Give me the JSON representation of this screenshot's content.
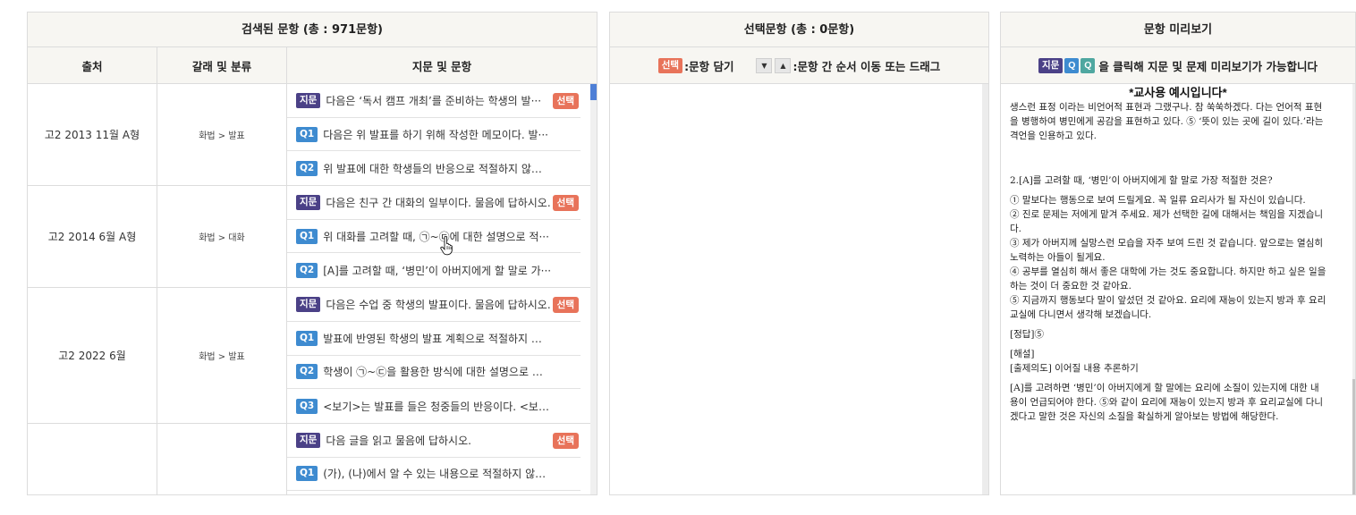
{
  "search_panel": {
    "title": "검색된 문항 (총 : 971문항)",
    "columns": [
      "출처",
      "갈래 및 분류",
      "지문 및 문항"
    ],
    "select_label": "선택",
    "groups": [
      {
        "source": "고2 2013 11월 A형",
        "category": "화법 > 발표",
        "items": [
          {
            "tag": "지문",
            "type": "passage",
            "text": "다음은 ‘독서 캠프 개최’를 준비하는 학생의 발···",
            "selectable": true
          },
          {
            "tag": "Q1",
            "type": "q",
            "text": "다음은 위 발표를 하기 위해 작성한 메모이다. 발···",
            "selectable": false
          },
          {
            "tag": "Q2",
            "type": "q",
            "text": "위 발표에 대한 학생들의 반응으로 적절하지 않은···",
            "selectable": false
          }
        ]
      },
      {
        "source": "고2 2014 6월 A형",
        "category": "화법 > 대화",
        "items": [
          {
            "tag": "지문",
            "type": "passage",
            "text": "다음은 친구 간 대화의 일부이다. 물음에 답하시오.",
            "selectable": true
          },
          {
            "tag": "Q1",
            "type": "q",
            "text": "위 대화를 고려할 때, ㉠~㉢에 대한 설명으로 적···",
            "selectable": false
          },
          {
            "tag": "Q2",
            "type": "q",
            "text": "[A]를 고려할 때, ‘병민’이 아버지에게 할 말로 가···",
            "selectable": false
          }
        ]
      },
      {
        "source": "고2 2022 6월",
        "category": "화법 > 발표",
        "items": [
          {
            "tag": "지문",
            "type": "passage",
            "text": "다음은 수업 중 학생의 발표이다. 물음에 답하시오.",
            "selectable": true
          },
          {
            "tag": "Q1",
            "type": "q",
            "text": "발표에 반영된 학생의 발표 계획으로 적절하지 않···",
            "selectable": false
          },
          {
            "tag": "Q2",
            "type": "q",
            "text": "학생이 ㉠~㉢을 활용한 방식에 대한 설명으로 가···",
            "selectable": false
          },
          {
            "tag": "Q3",
            "type": "q",
            "text": "<보기>는 발표를 들은 청중들의 반응이다. <보기···",
            "selectable": false
          }
        ]
      },
      {
        "source": "",
        "category": "",
        "items": [
          {
            "tag": "지문",
            "type": "passage",
            "text": "다음 글을 읽고 물음에 답하시오.",
            "selectable": true
          },
          {
            "tag": "Q1",
            "type": "q",
            "text": "(가), (나)에서 알 수 있는 내용으로 적절하지 않은···",
            "selectable": false
          },
          {
            "tag": "",
            "type": "blank",
            "text": "",
            "selectable": false
          }
        ]
      }
    ]
  },
  "selected_panel": {
    "title": "선택문항 (총 : 0문항)",
    "hint_select_tag": "선택",
    "hint_select_text": ":문항 담기",
    "hint_order_text": ":문항 간 순서 이동 또는 드래그",
    "down_arrow": "▼",
    "up_arrow": "▲"
  },
  "preview_panel": {
    "title": "문항 미리보기",
    "hint_tag_passage": "지문",
    "hint_tag_q": "Q",
    "hint_text": "을 클릭해 지문 및 문제 미리보기가 가능합니다",
    "header": "*교사용 예시입니다*",
    "top_text": "생스런 표정 이라는 비언어적 표현과 그랬구나. 참 쑥쑥하겠다. 다는 언어적 표현을 병행하여 병민에게 공감을 표현하고 있다. ⑤ ‘뜻이 있는 곳에 길이 있다.’라는 격언을 인용하고 있다.",
    "question": "2.[A]를 고려할 때, ‘병민’이 아버지에게 할 말로 가장 적절한 것은?",
    "options": [
      "① 말보다는 행동으로 보여 드릴게요. 꼭 일류 요리사가 될 자신이 있습니다.",
      "② 진로 문제는 저에게 맡겨 주세요. 제가 선택한 길에 대해서는 책임을 지겠습니다.",
      "③ 제가 아버지께 실망스런 모습을 자주 보여 드린 것 같습니다. 앞으로는 열심히 노력하는 아들이 될게요.",
      "④ 공부를 열심히 해서 좋은 대학에 가는 것도 중요합니다. 하지만 하고 싶은 일을 하는 것이 더 중요한 것 같아요.",
      "⑤ 지금까지 행동보다 말이 앞섰던 것 같아요. 요리에 재능이 있는지 방과 후 요리교실에 다니면서 생각해 보겠습니다."
    ],
    "answer": "[정답]⑤",
    "explanation_label": "[해설]",
    "intent": "[출제의도] 이어질 내용 추론하기",
    "explanation": "[A]를 고려하면 ‘병민’이 아버지에게 할 말에는 요리에 소질이 있는지에 대한 내용이 언급되어야 한다. ⑤와 같이 요리에 재능이 있는지 방과 후 요리교실에 다니겠다고 말한 것은 자신의 소질을 확실하게 알아보는 방법에 해당한다."
  },
  "colors": {
    "passage_tag": "#4b4187",
    "q_tag": "#3e8bd0",
    "select_btn": "#e8735a",
    "preview_q_tag": "#4fa7a0",
    "scroll_thumb": "#4e7fd6"
  },
  "icons": {
    "cursor": "hand-pointer-icon"
  }
}
